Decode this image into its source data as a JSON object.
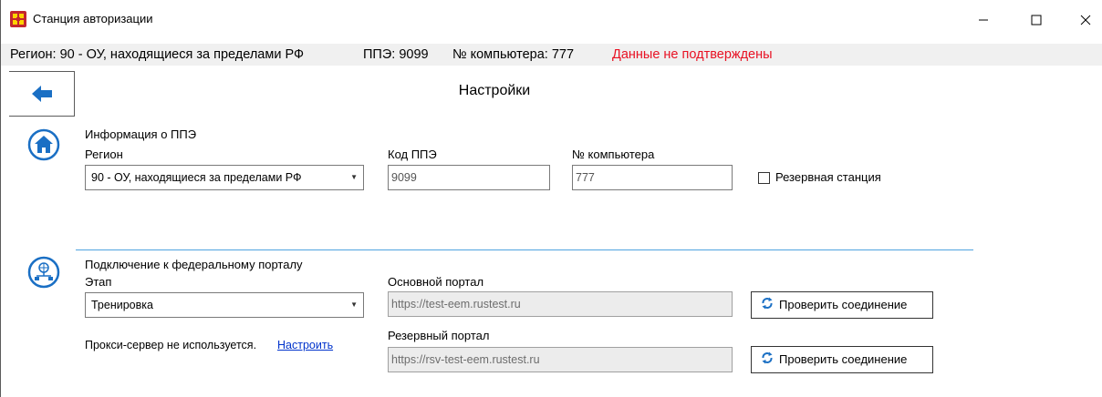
{
  "window": {
    "title": "Станция авторизации",
    "controls": {
      "minimize": "—",
      "maximize": "☐",
      "close": "✕"
    }
  },
  "status": {
    "region": "Регион: 90 - ОУ, находящиеся за пределами РФ",
    "ppe": "ППЭ: 9099",
    "computer": "№ компьютера: 777",
    "warning": "Данные не подтверждены",
    "warning_color": "#e81123"
  },
  "header": {
    "back_icon": "arrow-left-icon",
    "title": "Настройки"
  },
  "ppe_info": {
    "section_icon": "home-icon",
    "section_title": "Информация о ППЭ",
    "region_label": "Регион",
    "region_value": "90 - ОУ, находящиеся за пределами РФ",
    "code_label": "Код ППЭ",
    "code_value": "9099",
    "computer_label": "№ компьютера",
    "computer_value": "777",
    "reserve_label": "Резервная станция",
    "reserve_checked": false
  },
  "portal": {
    "section_icon": "network-globe-icon",
    "section_title": "Подключение к федеральному порталу",
    "stage_label": "Этап",
    "stage_value": "Тренировка",
    "main_portal_label": "Основной портал",
    "main_portal_value": "https://test-eem.rustest.ru",
    "reserve_portal_label": "Резервный портал",
    "reserve_portal_value": "https://rsv-test-eem.rustest.ru",
    "check_button": "Проверить соединение",
    "proxy_text": "Прокси-сервер не используется.",
    "proxy_link": "Настроить",
    "accent_color": "#1a6fc4"
  }
}
